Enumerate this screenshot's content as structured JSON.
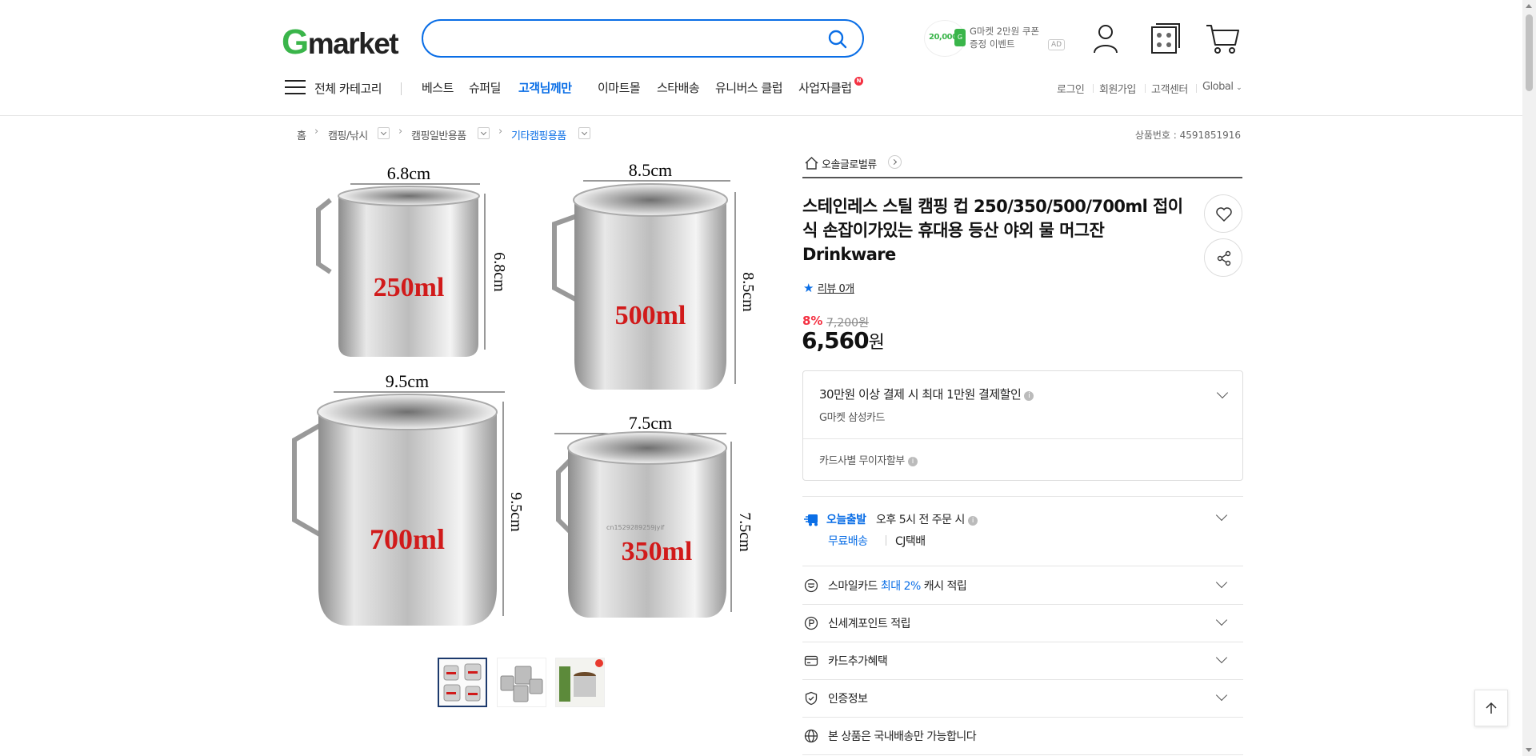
{
  "header": {
    "logo_g": "G",
    "logo_rest": "market",
    "search_placeholder": "",
    "ad": {
      "coin_amount": "20,000",
      "badge": "G",
      "line1": "G마켓 2만원 쿠폰",
      "line2": "증정 이벤트",
      "label": "AD"
    }
  },
  "nav": {
    "all_categories": "전체 카테고리",
    "items": [
      "베스트",
      "슈퍼딜",
      "고객님께만",
      "이마트몰",
      "스타배송",
      "유니버스 클럽",
      "사업자클럽"
    ],
    "new_badge": "N",
    "utils": [
      "로그인",
      "회원가입",
      "고객센터",
      "Global"
    ]
  },
  "breadcrumb": {
    "items": [
      "홈",
      "캠핑/낚시",
      "캠핑일반용품",
      "기타캠핑용품"
    ],
    "product_no": "상품번호 : 4591851916"
  },
  "product_image": {
    "cups": [
      {
        "label": "250ml",
        "width": "6.8cm",
        "height": "6.8cm"
      },
      {
        "label": "500ml",
        "width": "8.5cm",
        "height": "8.5cm"
      },
      {
        "label": "700ml",
        "width": "9.5cm",
        "height": "9.5cm"
      },
      {
        "label": "350ml",
        "width": "7.5cm",
        "height": "7.5cm"
      }
    ],
    "watermark": "cn1529289259jyif",
    "thumbnails_count": 3
  },
  "product": {
    "seller": "오솔글로벌류",
    "title": "스테인레스 스틸 캠핑 컵 250/350/500/700ml 접이식 손잡이가있는 휴대용 등산 야외 물 머그잔 Drinkware",
    "review": "리뷰 0개",
    "discount": "8%",
    "original_price": "7,200원",
    "price": "6,560",
    "price_unit": "원"
  },
  "card_benefit": {
    "title": "30만원 이상 결제 시 최대 1만원 결제할인",
    "subtitle": "G마켓 삼성카드",
    "installment": "카드사별 무이자할부"
  },
  "delivery": {
    "today_label": "오늘출발",
    "cutoff": "오후 5시 전 주문 시",
    "free": "무료배송",
    "carrier": "CJ택배"
  },
  "rows": {
    "smile_prefix": "스마일카드 ",
    "smile_highlight": "최대 2%",
    "smile_suffix": " 캐시 적립",
    "point": "신세계포인트 적립",
    "card_extra": "카드추가혜택",
    "certification": "인증정보",
    "domestic": "본 상품은 국내배송만 가능합니다"
  },
  "colors": {
    "brand_blue": "#0a6ee6",
    "brand_green": "#3ab54a",
    "discount_red": "#f43142"
  }
}
